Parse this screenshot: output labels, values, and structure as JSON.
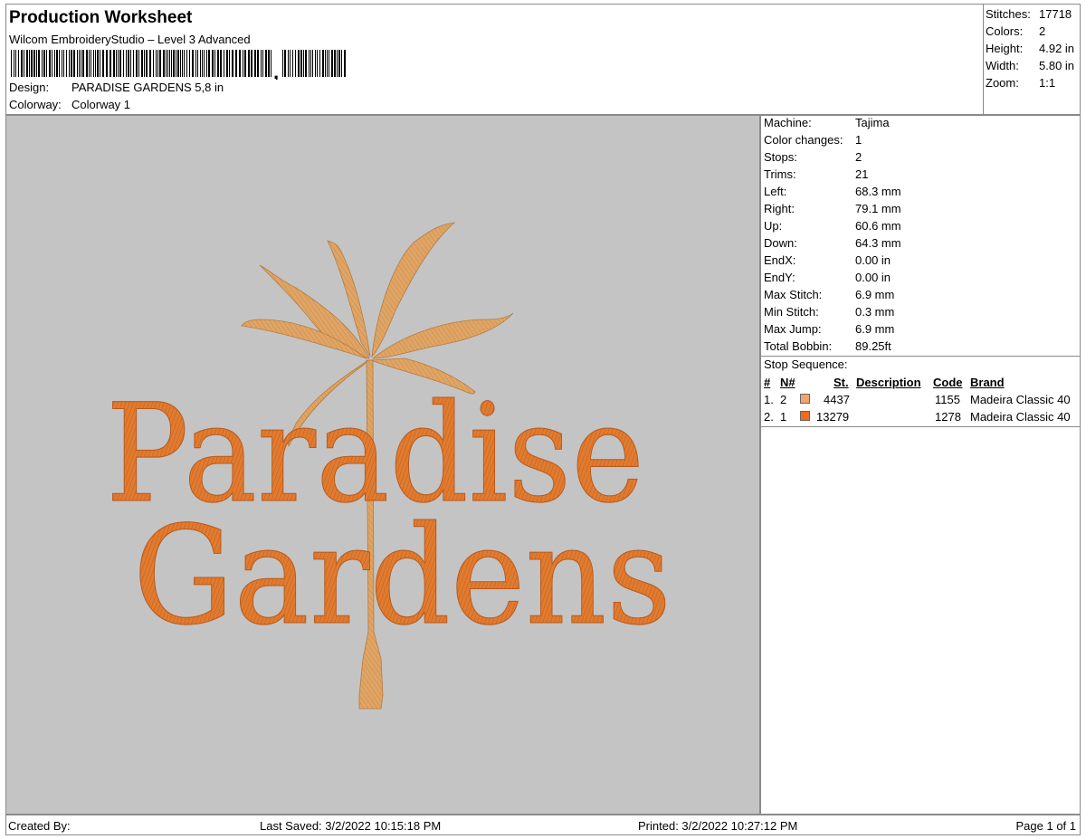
{
  "header": {
    "title": "Production Worksheet",
    "software": "Wilcom EmbroideryStudio – Level 3 Advanced",
    "design_label": "Design:",
    "design_value": "PARADISE GARDENS 5,8 in",
    "colorway_label": "Colorway:",
    "colorway_value": "Colorway 1"
  },
  "stats": [
    {
      "label": "Stitches:",
      "value": "17718"
    },
    {
      "label": "Colors:",
      "value": "2"
    },
    {
      "label": "Height:",
      "value": "4.92 in"
    },
    {
      "label": "Width:",
      "value": "5.80 in"
    },
    {
      "label": "Zoom:",
      "value": "1:1"
    }
  ],
  "machine_info": [
    {
      "label": "Machine:",
      "value": "Tajima"
    },
    {
      "label": "Color changes:",
      "value": "1"
    },
    {
      "label": "Stops:",
      "value": "2"
    },
    {
      "label": "Trims:",
      "value": "21"
    },
    {
      "label": "Left:",
      "value": "68.3 mm"
    },
    {
      "label": "Right:",
      "value": "79.1 mm"
    },
    {
      "label": "Up:",
      "value": "60.6 mm"
    },
    {
      "label": "Down:",
      "value": "64.3 mm"
    },
    {
      "label": "EndX:",
      "value": "0.00 in"
    },
    {
      "label": "EndY:",
      "value": "0.00 in"
    },
    {
      "label": "Max Stitch:",
      "value": "6.9 mm"
    },
    {
      "label": "Min Stitch:",
      "value": "0.3 mm"
    },
    {
      "label": "Max Jump:",
      "value": "6.9 mm"
    },
    {
      "label": "Total Bobbin:",
      "value": "89.25ft"
    }
  ],
  "stop_sequence": {
    "title": "Stop Sequence:",
    "headers": {
      "num": "#",
      "n": "N#",
      "st": "St.",
      "description": "Description",
      "code": "Code",
      "brand": "Brand"
    },
    "rows": [
      {
        "num": "1.",
        "n": "2",
        "color": "#f0a56c",
        "st": "4437",
        "description": "",
        "code": "1155",
        "brand": "Madeira Classic 40"
      },
      {
        "num": "2.",
        "n": "1",
        "color": "#f26a1e",
        "st": "13279",
        "description": "",
        "code": "1278",
        "brand": "Madeira Classic 40"
      }
    ]
  },
  "design_preview": {
    "line1": "Paradise",
    "line2": "Gardens",
    "palm_color": "#e0a565",
    "text_color": "#e07b30",
    "background": "#c4c4c4"
  },
  "footer": {
    "created_by": "Created By:",
    "last_saved": "Last Saved: 3/2/2022 10:15:18 PM",
    "printed": "Printed: 3/2/2022 10:27:12 PM",
    "page": "Page 1 of 1"
  }
}
